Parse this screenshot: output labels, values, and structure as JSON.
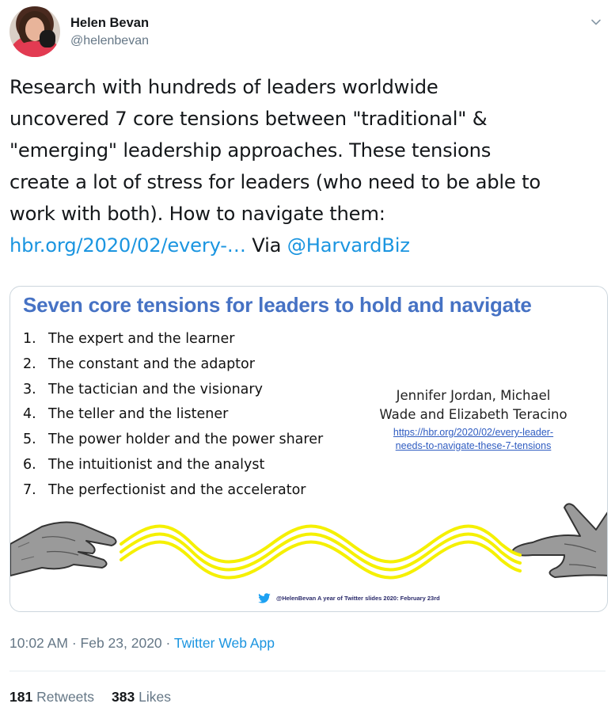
{
  "author": {
    "display_name": "Helen Bevan",
    "handle": "@helenbevan"
  },
  "tweet": {
    "lines": [
      "Research with hundreds of leaders worldwide",
      "uncovered 7 core tensions between \"traditional\" &",
      "\"emerging\" leadership approaches. These tensions",
      "create a lot of stress for leaders (who need to be able to",
      "work with both). How to navigate them:"
    ],
    "link_text": "hbr.org/2020/02/every-…",
    "via_text": "Via",
    "mention": "@HarvardBiz"
  },
  "slide": {
    "title": "Seven core tensions for leaders to hold and navigate",
    "tensions": [
      {
        "num": "1.",
        "text": "The expert and the learner"
      },
      {
        "num": "2.",
        "text": "The constant and the adaptor"
      },
      {
        "num": "3.",
        "text": "The tactician and the visionary"
      },
      {
        "num": "4.",
        "text": "The teller and the listener"
      },
      {
        "num": "5.",
        "text": "The power holder and the power sharer"
      },
      {
        "num": "6.",
        "text": "The intuitionist and the analyst"
      },
      {
        "num": "7.",
        "text": "The perfectionist and the accelerator"
      }
    ],
    "authors_line1": "Jennifer Jordan, Michael",
    "authors_line2": "Wade and Elizabeth Teracino",
    "link_line1": "https://hbr.org/2020/02/every-leader-",
    "link_line2": "needs-to-navigate-these-7-tensions",
    "credit": "@HelenBevan A year of Twitter slides 2020: February 23rd"
  },
  "meta": {
    "time": "10:02 AM",
    "sep1": "·",
    "date": "Feb 23, 2020",
    "sep2": "·",
    "source": "Twitter Web App"
  },
  "stats": {
    "retweets_count": "181",
    "retweets_label": "Retweets",
    "likes_count": "383",
    "likes_label": "Likes"
  },
  "colors": {
    "link": "#1b95e0",
    "slide_title": "#4672c4",
    "wave": "#f5f000",
    "secondary_text": "#657786"
  },
  "icons": [
    "chevron-down-icon",
    "twitter-bird-icon"
  ]
}
